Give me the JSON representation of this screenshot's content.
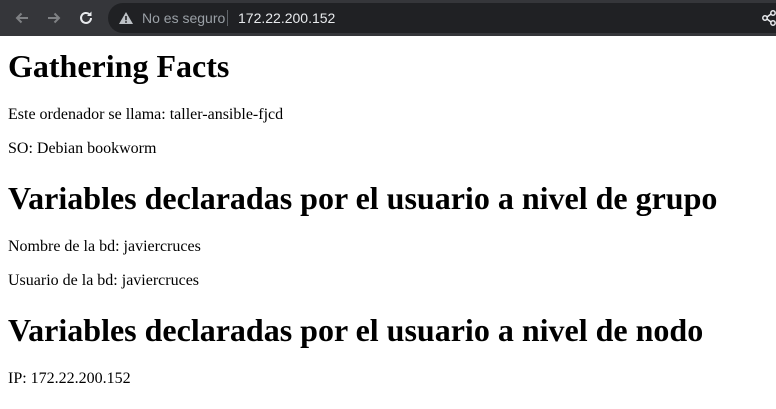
{
  "browser": {
    "security_label": "No es seguro",
    "url": "172.22.200.152",
    "icons": [
      "back-arrow-icon",
      "forward-arrow-icon",
      "reload-icon",
      "warning-icon",
      "share-icon"
    ]
  },
  "page": {
    "sections": [
      {
        "heading": "Gathering Facts",
        "lines": [
          "Este ordenador se llama: taller-ansible-fjcd",
          "SO: Debian bookworm"
        ]
      },
      {
        "heading": "Variables declaradas por el usuario a nivel de grupo",
        "lines": [
          "Nombre de la bd: javiercruces",
          "Usuario de la bd: javiercruces"
        ]
      },
      {
        "heading": "Variables declaradas por el usuario a nivel de nodo",
        "lines": [
          "IP: 172.22.200.152"
        ]
      }
    ]
  }
}
